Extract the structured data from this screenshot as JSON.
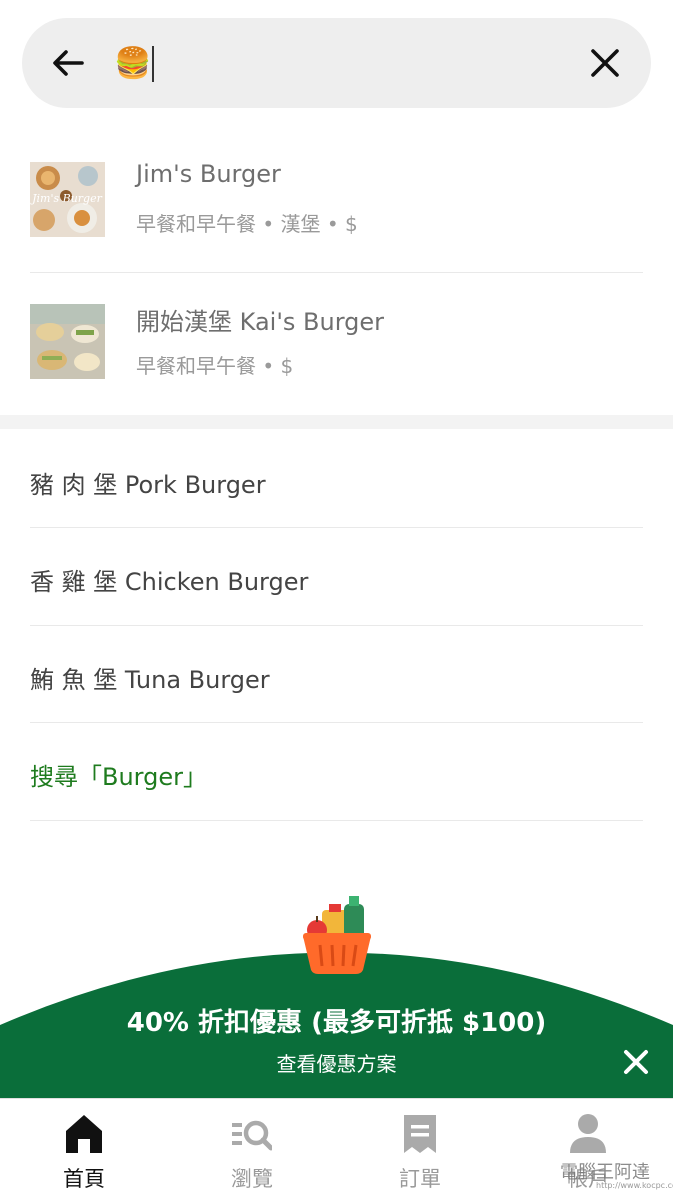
{
  "search": {
    "query": "🍔"
  },
  "restaurants": [
    {
      "name": "Jim's Burger",
      "meta": "早餐和早午餐 • 漢堡 • $",
      "thumb_text": "Jim's Burger"
    },
    {
      "name": "開始漢堡 Kai's Burger",
      "meta": "早餐和早午餐 • $"
    }
  ],
  "suggestions": [
    "豬 肉 堡 Pork Burger",
    "香 雞 堡 Chicken Burger",
    "鮪 魚 堡 Tuna Burger"
  ],
  "search_suggestion": "搜尋「Burger」",
  "promo": {
    "title": "40% 折扣優惠 (最多可折抵 $100)",
    "subtitle": "查看優惠方案",
    "color": "#0a6e3a"
  },
  "nav": {
    "items": [
      {
        "label": "首頁",
        "icon": "home-icon",
        "active": true
      },
      {
        "label": "瀏覽",
        "icon": "browse-icon"
      },
      {
        "label": "訂單",
        "icon": "receipt-icon"
      },
      {
        "label": "帳戶",
        "icon": "user-icon"
      }
    ]
  },
  "watermark": {
    "text": "電腦王阿達",
    "url": "http://www.kocpc.com.tw"
  },
  "colors": {
    "accent_green": "#1e7b1e",
    "promo_green": "#0a6e3a",
    "search_bg": "#eeeeee"
  }
}
